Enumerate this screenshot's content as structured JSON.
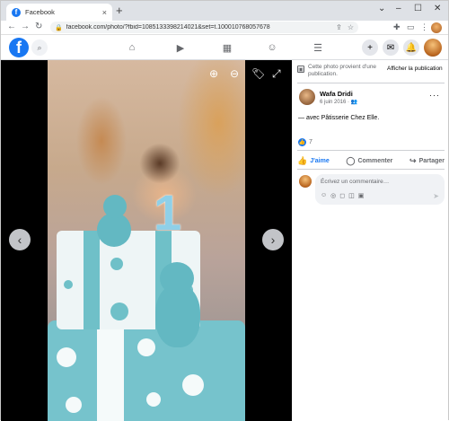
{
  "browser": {
    "tab_title": "Facebook",
    "tab_close": "×",
    "new_tab": "+",
    "window_controls": [
      "⌄",
      "–",
      "☐",
      "✕"
    ],
    "nav": {
      "back": "←",
      "forward": "→",
      "reload": "↻"
    },
    "url": "facebook.com/photo/?fbid=1085133398214021&set=t.100010768057678",
    "url_icons": [
      "⇪",
      "☆"
    ],
    "extension_icons": [
      "✚",
      "▭",
      "⋮"
    ]
  },
  "fb_header": {
    "logo": "f",
    "search_icon": "⌕",
    "nav_icons": [
      "⌂",
      "▶",
      "▦",
      "☺",
      "☰"
    ],
    "right_buttons": [
      "+",
      "✉",
      "🔔"
    ]
  },
  "photo_viewer": {
    "candle_number": "1",
    "tools": [
      "⊕",
      "⊖",
      "🏷",
      "⤢"
    ],
    "prev": "‹",
    "next": "›"
  },
  "panel": {
    "notice_icon": "▣",
    "notice_text": "Cette photo provient d'une publication.",
    "notice_link": "Afficher la publication",
    "author_name": "Wafa Dridi",
    "post_date": "6 juin 2016 · 👥",
    "more": "···",
    "caption": "— avec Pâtisserie Chez Elle.",
    "like_icon": "👍",
    "reaction_count": "7",
    "actions": [
      {
        "icon": "👍",
        "label": "J'aime"
      },
      {
        "icon": "◯",
        "label": "Commenter"
      },
      {
        "icon": "↪",
        "label": "Partager"
      }
    ],
    "comment_placeholder": "Écrivez un commentaire…",
    "comment_tools": [
      "☺",
      "◎",
      "◻",
      "◫",
      "▣"
    ],
    "send_icon": "➤"
  }
}
